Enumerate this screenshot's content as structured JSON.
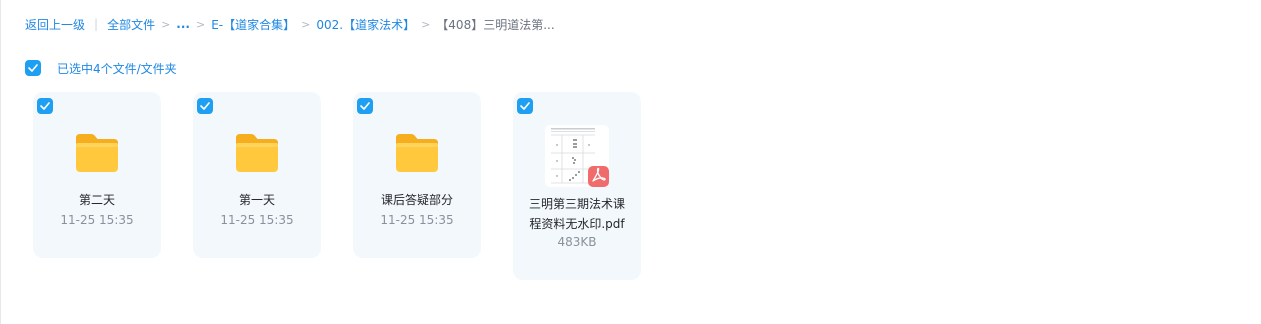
{
  "breadcrumb": {
    "back_label": "返回上一级",
    "all_files_label": "全部文件",
    "ellipsis": "...",
    "items": [
      {
        "label": "E-【道家合集】"
      },
      {
        "label": "002.【道家法术】"
      }
    ],
    "current": "【408】三明道法第..."
  },
  "selection": {
    "text": "已选中4个文件/文件夹",
    "checked": true
  },
  "files": [
    {
      "name": "第二天",
      "meta": "11-25 15:35",
      "type": "folder",
      "icon": "folder-icon",
      "checked": true
    },
    {
      "name": "第一天",
      "meta": "11-25 15:35",
      "type": "folder",
      "icon": "folder-icon",
      "checked": true
    },
    {
      "name": "课后答疑部分",
      "meta": "11-25 15:35",
      "type": "folder",
      "icon": "folder-icon",
      "checked": true
    },
    {
      "name_line1": "三明第三期法术课",
      "name_line2": "程资料无水印.pdf",
      "meta": "483KB",
      "type": "pdf",
      "icon": "pdf-icon",
      "checked": true
    }
  ],
  "colors": {
    "accent": "#1e88e5",
    "checkbox": "#1e9ff2",
    "card_bg": "#f3f8fc",
    "folder": "#ffc83d",
    "pdf_badge": "#f06b6b"
  }
}
